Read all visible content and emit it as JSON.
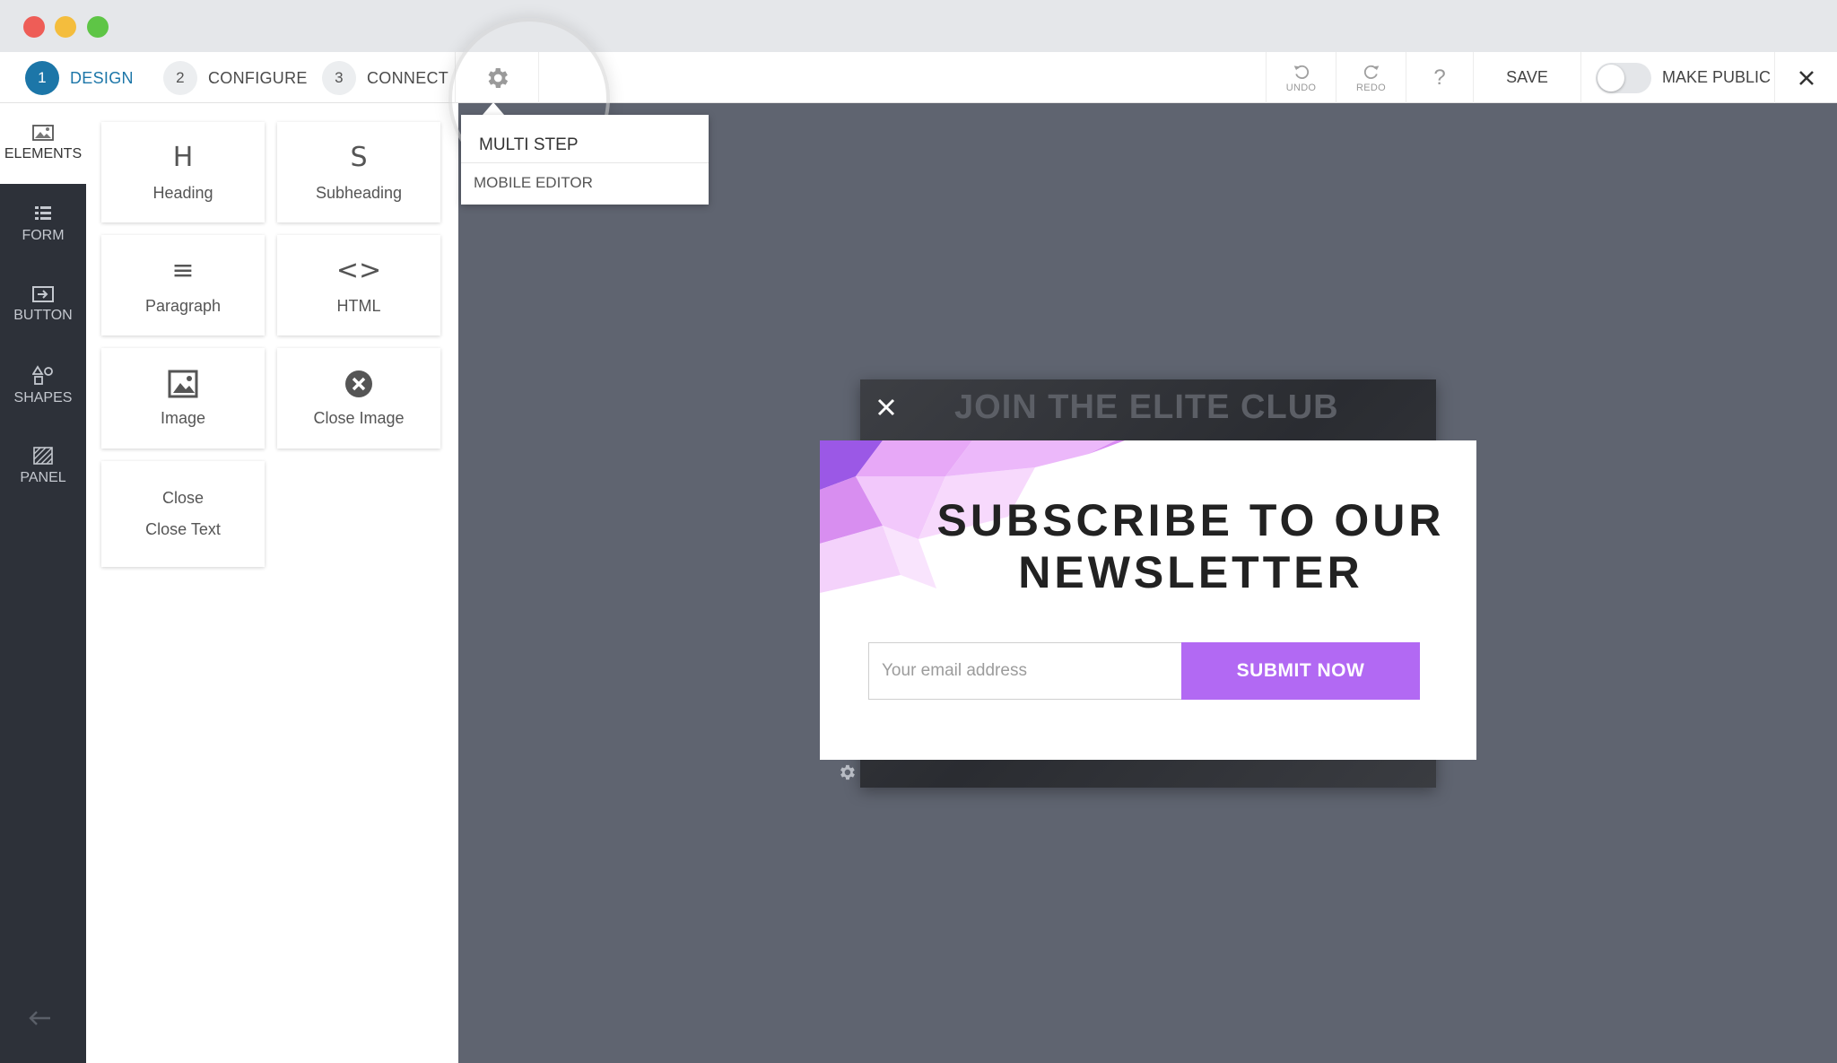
{
  "steps": [
    {
      "num": "1",
      "label": "DESIGN"
    },
    {
      "num": "2",
      "label": "CONFIGURE"
    },
    {
      "num": "3",
      "label": "CONNECT"
    }
  ],
  "toolbar": {
    "undo": "UNDO",
    "redo": "REDO",
    "help": "?",
    "save": "SAVE",
    "make_public": "MAKE PUBLIC"
  },
  "leftnav": [
    {
      "label": "ELEMENTS",
      "icon": "image-icon"
    },
    {
      "label": "FORM",
      "icon": "form-icon"
    },
    {
      "label": "BUTTON",
      "icon": "button-icon"
    },
    {
      "label": "SHAPES",
      "icon": "shapes-icon"
    },
    {
      "label": "PANEL",
      "icon": "panel-icon"
    }
  ],
  "elements": [
    {
      "glyph": "H",
      "label": "Heading"
    },
    {
      "glyph": "S",
      "label": "Subheading"
    },
    {
      "glyph": "≡",
      "label": "Paragraph"
    },
    {
      "glyph": "<>",
      "label": "HTML"
    },
    {
      "glyph": "",
      "label": "Image"
    },
    {
      "glyph": "",
      "label": "Close Image"
    },
    {
      "glyph": "Close",
      "label": "Close Text"
    }
  ],
  "dropdown": {
    "items": [
      "MULTI STEP",
      "MOBILE EDITOR"
    ]
  },
  "popup": {
    "bg_title": "JOIN THE ELITE CLUB",
    "title": "SUBSCRIBE TO OUR NEWSLETTER",
    "email_placeholder": "Your email address",
    "submit_label": "SUBMIT NOW"
  },
  "colors": {
    "accent": "#1c76a8",
    "submit": "#b269f3",
    "canvas": "#5f6470",
    "nav": "#2d3139"
  }
}
